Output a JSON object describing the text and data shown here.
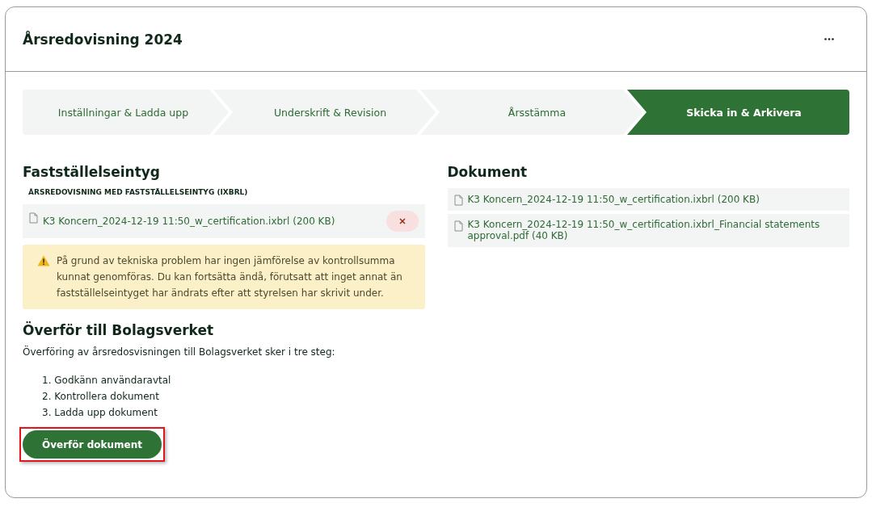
{
  "card": {
    "title": "Årsredovisning 2024"
  },
  "steps": [
    {
      "label": "Inställningar & Ladda upp",
      "selected": false
    },
    {
      "label": "Underskrift & Revision",
      "selected": false
    },
    {
      "label": "Årsstämma",
      "selected": false
    },
    {
      "label": "Skicka in & Arkivera",
      "selected": true
    }
  ],
  "certificate": {
    "heading": "Fastställelseintyg",
    "sublabel": "ÅRSREDOVISNING MED FASTSTÄLLELSEINTYG (IXBRL)",
    "file": "K3 Koncern_2024-12-19 11:50_w_certification.ixbrl (200 KB)",
    "warning": "På grund av tekniska problem har ingen jämförelse av kontrollsumma kunnat genomföras. Du kan fortsätta ändå, förutsatt att inget annat än fastställelseintyget har ändrats efter att styrelsen har skrivit under."
  },
  "transfer": {
    "heading": "Överför till Bolagsverket",
    "intro": "Överföring av årsredosvisningen till Bolagsverket sker i tre steg:",
    "steps": [
      "1. Godkänn användaravtal",
      "2. Kontrollera dokument",
      "3. Ladda upp dokument"
    ],
    "button": "Överför dokument",
    "highlighted": true
  },
  "documents": {
    "heading": "Dokument",
    "files": [
      "K3 Koncern_2024-12-19 11:50_w_certification.ixbrl (200 KB)",
      "K3 Koncern_2024-12-19 11:50_w_certification.ixbrl_Financial statements approval.pdf (40 KB)"
    ]
  }
}
